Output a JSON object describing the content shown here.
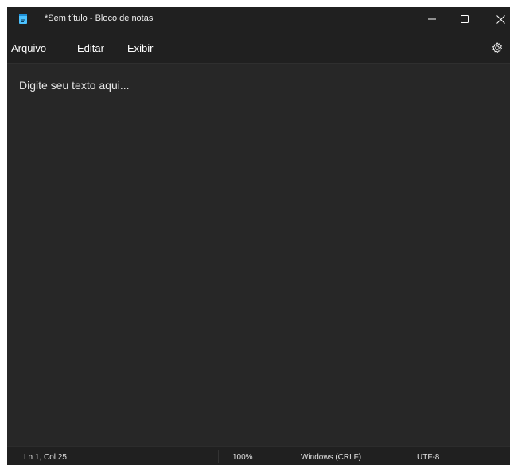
{
  "window": {
    "title": "*Sem título - Bloco de notas",
    "app_icon": "notepad-icon",
    "controls": {
      "minimize_icon": "minimize-icon",
      "maximize_icon": "maximize-icon",
      "close_icon": "close-icon"
    }
  },
  "menubar": {
    "items": [
      {
        "label": "Arquivo"
      },
      {
        "label": "Editar"
      },
      {
        "label": "Exibir"
      }
    ],
    "settings_icon": "gear-icon"
  },
  "editor": {
    "content": "Digite seu texto aqui..."
  },
  "statusbar": {
    "position": "Ln 1, Col 25",
    "zoom": "100%",
    "line_ending": "Windows (CRLF)",
    "encoding": "UTF-8"
  },
  "colors": {
    "titlebar_bg": "#202020",
    "editor_bg": "#272727",
    "text": "#ffffff",
    "app_icon_accent": "#4cc2ff"
  }
}
